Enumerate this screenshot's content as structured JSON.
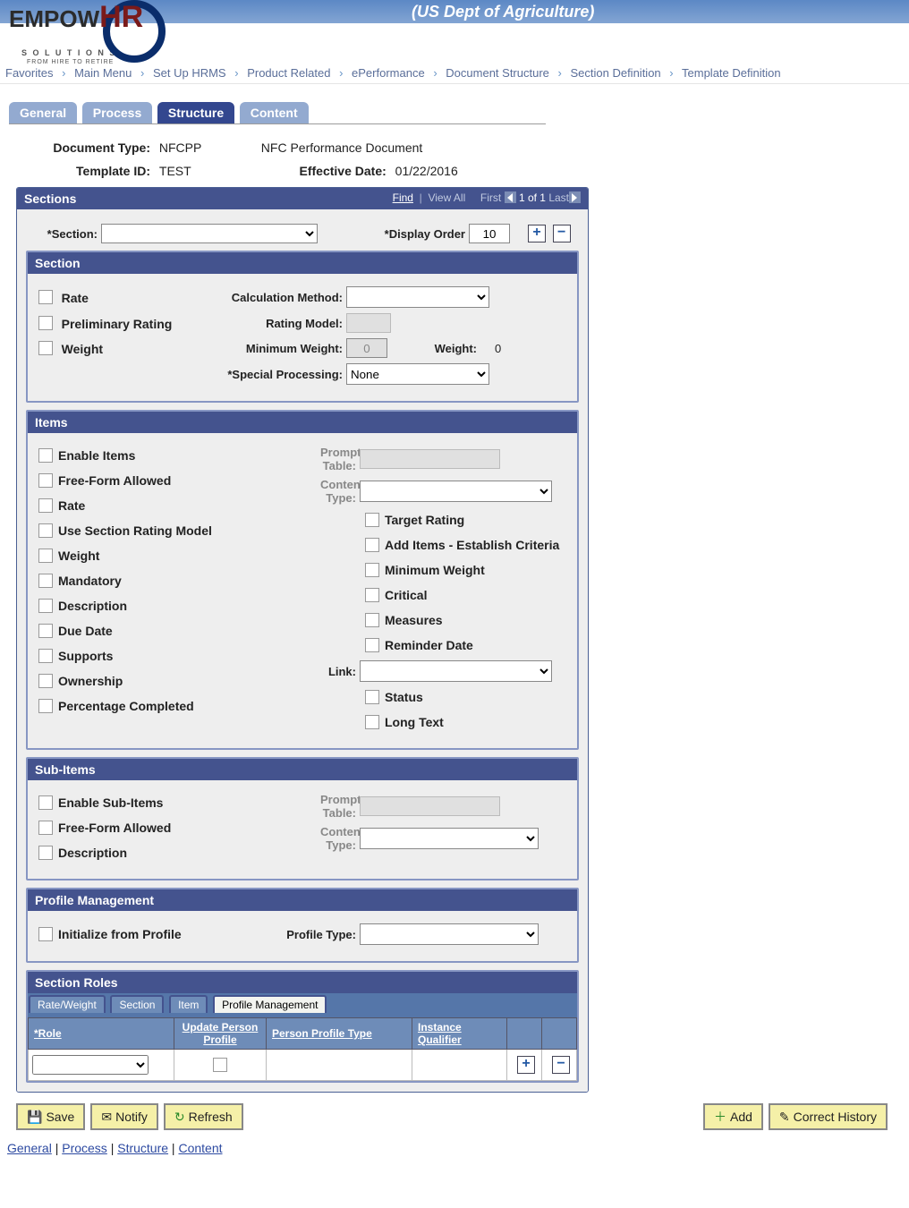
{
  "banner": {
    "title": "(US Dept of Agriculture)"
  },
  "logo": {
    "main": "EMPOW",
    "hr": "HR",
    "sub1": "S O L U T I O N S",
    "sub2": "FROM HIRE TO RETIRE"
  },
  "breadcrumb": [
    "Favorites",
    "Main Menu",
    "Set Up HRMS",
    "Product Related",
    "ePerformance",
    "Document Structure",
    "Section Definition",
    "Template Definition"
  ],
  "tabs": {
    "items": [
      "General",
      "Process",
      "Structure",
      "Content"
    ],
    "active": 2
  },
  "header": {
    "doc_type_label": "Document Type:",
    "doc_type_value": "NFCPP",
    "doc_type_desc": "NFC Performance Document",
    "tmpl_id_label": "Template ID:",
    "tmpl_id_value": "TEST",
    "eff_date_label": "Effective Date:",
    "eff_date_value": "01/22/2016"
  },
  "sections_bar": {
    "title": "Sections",
    "find": "Find",
    "view_all": "View All",
    "first": "First",
    "counter": "1 of 1",
    "last": "Last",
    "section_label": "*Section:",
    "display_order_label": "*Display Order",
    "display_order_value": "10"
  },
  "section_box": {
    "title": "Section",
    "rate": "Rate",
    "prelim": "Preliminary Rating",
    "weight": "Weight",
    "calc_method": "Calculation Method:",
    "rating_model": "Rating Model:",
    "min_weight": "Minimum Weight:",
    "min_weight_val": "0",
    "weight_label": "Weight:",
    "weight_val": "0",
    "special_proc": "*Special Processing:",
    "special_proc_val": "None"
  },
  "items_box": {
    "title": "Items",
    "prompt_table": "Prompt Table:",
    "content_type": "Content Type:",
    "link_label": "Link:",
    "left": [
      "Enable Items",
      "Free-Form Allowed",
      "Rate",
      "Use Section Rating Model",
      "Weight",
      "Mandatory",
      "Description",
      "Due Date",
      "Supports",
      "Ownership",
      "Percentage Completed"
    ],
    "right": [
      "",
      "",
      "Target Rating",
      "Add Items - Establish Criteria",
      "Minimum Weight",
      "Critical",
      "Measures",
      "Reminder Date",
      "",
      "Status",
      "Long Text"
    ]
  },
  "subitems_box": {
    "title": "Sub-Items",
    "prompt_table": "Prompt Table:",
    "content_type": "Content Type:",
    "enable": "Enable Sub-Items",
    "freeform": "Free-Form Allowed",
    "description": "Description"
  },
  "profile_box": {
    "title": "Profile Management",
    "init": "Initialize from Profile",
    "profile_type": "Profile Type:"
  },
  "roles": {
    "title": "Section Roles",
    "subtabs": [
      "Rate/Weight",
      "Section",
      "Item",
      "Profile Management"
    ],
    "active_subtab": 3,
    "cols": [
      "*Role",
      "Update Person Profile",
      "Person Profile Type",
      "Instance Qualifier"
    ]
  },
  "actions": {
    "save": "Save",
    "notify": "Notify",
    "refresh": "Refresh",
    "add": "Add",
    "correct": "Correct History"
  },
  "foot_links": [
    "General",
    "Process",
    "Structure",
    "Content"
  ]
}
